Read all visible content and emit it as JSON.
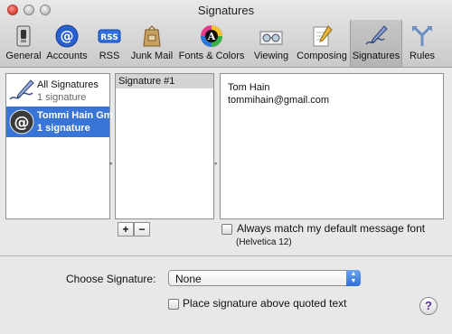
{
  "window": {
    "title": "Signatures"
  },
  "toolbar": {
    "items": [
      {
        "label": "General",
        "icon": "switch-icon"
      },
      {
        "label": "Accounts",
        "icon": "at-sign-icon"
      },
      {
        "label": "RSS",
        "icon": "rss-badge-icon"
      },
      {
        "label": "Junk Mail",
        "icon": "junk-bag-icon"
      },
      {
        "label": "Fonts & Colors",
        "icon": "color-font-icon"
      },
      {
        "label": "Viewing",
        "icon": "glasses-icon"
      },
      {
        "label": "Composing",
        "icon": "pencil-paper-icon"
      },
      {
        "label": "Signatures",
        "icon": "signature-pen-icon",
        "selected": true
      },
      {
        "label": "Rules",
        "icon": "rules-arrows-icon"
      }
    ]
  },
  "accounts": [
    {
      "name": "All Signatures",
      "count": "1 signature",
      "selected": false
    },
    {
      "name": "Tommi Hain Gm",
      "count": "1 signature",
      "selected": true
    }
  ],
  "signatures": {
    "items": [
      "Signature #1"
    ]
  },
  "signature_preview": {
    "line1": "Tom Hain",
    "line2": "tommihain@gmail.com"
  },
  "buttons": {
    "add": "+",
    "remove": "−"
  },
  "font_option": {
    "label": "Always match my default message font",
    "font_note": "(Helvetica 12)",
    "checked": false
  },
  "choose": {
    "label": "Choose Signature:",
    "value": "None"
  },
  "place_above": {
    "label": "Place signature above quoted text",
    "checked": false
  },
  "help": {
    "label": "?"
  },
  "colors": {
    "selection": "#3875d7",
    "popup_arrow": "#2f6fd6"
  }
}
